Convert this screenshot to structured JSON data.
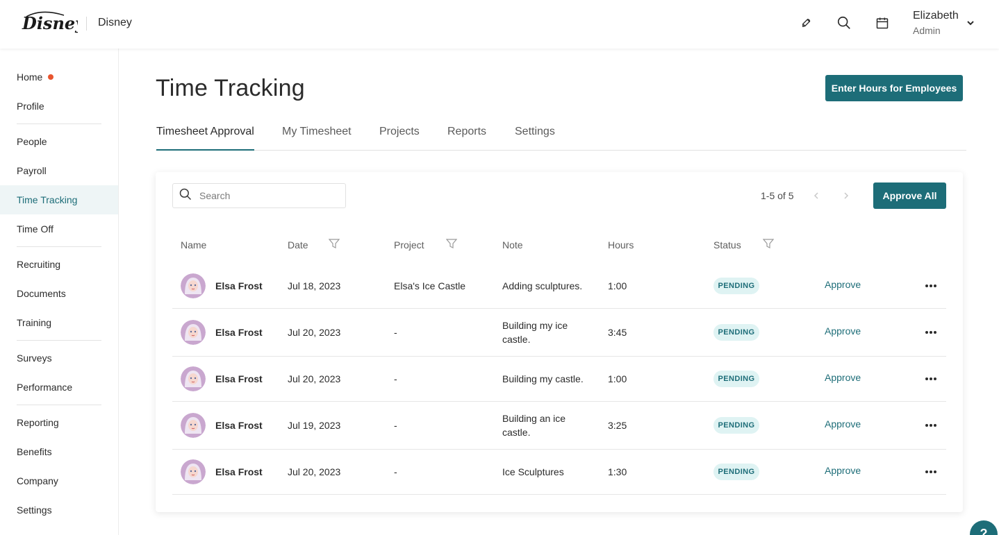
{
  "header": {
    "brand_name": "Disney",
    "logo_text": "Disney",
    "icons": [
      "rocket-icon",
      "search-icon",
      "calendar-icon"
    ],
    "user": {
      "name": "Elizabeth",
      "role": "Admin"
    }
  },
  "sidebar": {
    "items": [
      {
        "label": "Home"
      },
      {
        "label": "Profile"
      },
      {
        "label": "People"
      },
      {
        "label": "Payroll"
      },
      {
        "label": "Time Tracking"
      },
      {
        "label": "Time Off"
      },
      {
        "label": "Recruiting"
      },
      {
        "label": "Documents"
      },
      {
        "label": "Training"
      },
      {
        "label": "Surveys"
      },
      {
        "label": "Performance"
      },
      {
        "label": "Reporting"
      },
      {
        "label": "Benefits"
      },
      {
        "label": "Company"
      },
      {
        "label": "Settings"
      }
    ],
    "active": "Time Tracking"
  },
  "main": {
    "title": "Time Tracking",
    "enter_hours_button": "Enter Hours for Employees",
    "tabs": [
      {
        "label": "Timesheet Approval"
      },
      {
        "label": "My Timesheet"
      },
      {
        "label": "Projects"
      },
      {
        "label": "Reports"
      },
      {
        "label": "Settings"
      }
    ],
    "active_tab": "Timesheet Approval"
  },
  "table": {
    "search_placeholder": "Search",
    "pagination": "1-5 of 5",
    "approve_all_label": "Approve All",
    "columns": [
      "Name",
      "Date",
      "Project",
      "Note",
      "Hours",
      "Status"
    ],
    "action_label": "Approve",
    "rows": [
      {
        "name": "Elsa Frost",
        "date": "Jul 18, 2023",
        "project": "Elsa's Ice Castle",
        "note": "Adding sculptures.",
        "hours": "1:00",
        "status": "PENDING"
      },
      {
        "name": "Elsa Frost",
        "date": "Jul 20, 2023",
        "project": "-",
        "note": "Building my ice castle.",
        "hours": "3:45",
        "status": "PENDING"
      },
      {
        "name": "Elsa Frost",
        "date": "Jul 20, 2023",
        "project": "-",
        "note": "Building my castle.",
        "hours": "1:00",
        "status": "PENDING"
      },
      {
        "name": "Elsa Frost",
        "date": "Jul 19, 2023",
        "project": "-",
        "note": "Building an ice castle.",
        "hours": "3:25",
        "status": "PENDING"
      },
      {
        "name": "Elsa Frost",
        "date": "Jul 20, 2023",
        "project": "-",
        "note": "Ice Sculptures",
        "hours": "1:30",
        "status": "PENDING"
      }
    ]
  },
  "help_label": "?",
  "colors": {
    "accent": "#1d6d78",
    "notification_dot": "#e8552f",
    "badge_bg": "#dff3f3"
  }
}
